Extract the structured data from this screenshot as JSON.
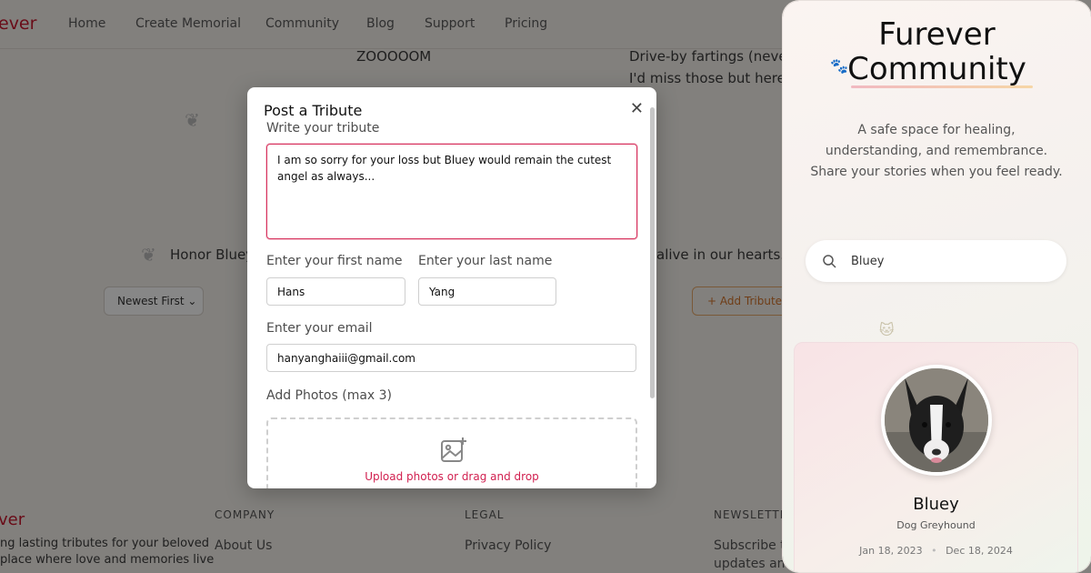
{
  "navbar": {
    "brand_fragment": "ever",
    "links": [
      "Home",
      "Create Memorial",
      "Community",
      "Blog",
      "Support",
      "Pricing"
    ]
  },
  "background": {
    "tribute_snippet_1": "ZOOOOOM",
    "tribute_snippet_2_line1": "Drive-by fartings (neve",
    "tribute_snippet_2_line2": "I'd miss those but here",
    "honor_text_left": "Honor Bluey'",
    "honor_text_right": "alive in our hearts.",
    "sort_label": "Newest First",
    "add_tribute_label": "Add Tribute",
    "footer_brand_fragment": "ver",
    "footer_desc_line1": "ng lasting tributes for your beloved",
    "footer_desc_line2": "place where love and memories live",
    "footer_columns": [
      {
        "heading": "COMPANY",
        "first_link": "About Us"
      },
      {
        "heading": "LEGAL",
        "first_link": "Privacy Policy"
      },
      {
        "heading": "NEWSLETTE",
        "first_link": "Subscribe t"
      }
    ],
    "footer_extra": "updates and"
  },
  "modal": {
    "title": "Post a Tribute",
    "close_icon": "close-icon",
    "tribute_label": "Write your tribute",
    "tribute_value": "I am so sorry for your loss but Bluey would remain the cutest angel as always... ",
    "first_name_label": "Enter your first name",
    "first_name_value": "Hans",
    "last_name_label": "Enter your last name",
    "last_name_value": "Yang",
    "email_label": "Enter your email",
    "email_value": "hanyanghaiii@gmail.com",
    "photos_label": "Add Photos (max 3)",
    "upload_text": "Upload photos or drag and drop",
    "upload_icon": "add-image-icon"
  },
  "panel": {
    "title_line1": "Furever",
    "title_line2": "Community",
    "description": "A safe space for healing, understanding, and remembrance. Share your stories when you feel ready.",
    "search_icon": "search-icon",
    "search_value": "Bluey",
    "pet": {
      "name": "Bluey",
      "breed": "Dog Greyhound",
      "birth_date": "Jan 18, 2023",
      "passing_date": "Dec 18, 2024",
      "date_separator": "•"
    }
  },
  "colors": {
    "brand_red": "#c8182e",
    "accent_pink": "#d11f4f",
    "overlay": "rgba(0,0,0,0.47)"
  }
}
